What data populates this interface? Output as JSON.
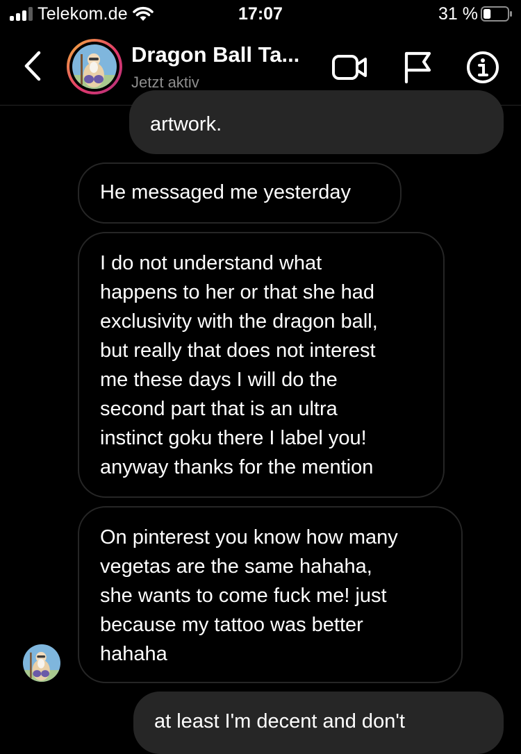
{
  "status_bar": {
    "carrier": "Telekom.de",
    "time": "17:07",
    "battery_percent": "31 %",
    "battery_level": 0.31,
    "signal_bars_active": 3,
    "signal_bars_total": 4
  },
  "header": {
    "title": "Dragon Ball Ta...",
    "subtitle": "Jetzt aktiv",
    "icons": [
      "back-chevron-icon",
      "video-camera-icon",
      "flag-icon",
      "info-icon"
    ]
  },
  "messages": [
    {
      "direction": "sent",
      "lines": [
        "artwork."
      ]
    },
    {
      "direction": "received",
      "lines": [
        "He messaged me yesterday"
      ]
    },
    {
      "direction": "received",
      "lines": [
        "I do not understand what",
        "happens to her or that she had",
        "exclusivity with the dragon ball,",
        "but really that does not interest",
        "me these days I will do the",
        "second part that is an ultra",
        "instinct goku there I label you!",
        "anyway thanks for the mention"
      ]
    },
    {
      "direction": "received",
      "lines": [
        "On pinterest you know how many",
        "vegetas are the same hahaha,",
        "she wants to come fuck me! just",
        "because my tattoo was better",
        "hahaha"
      ]
    },
    {
      "direction": "sent",
      "lines": [
        "at least I'm decent and don't"
      ]
    }
  ],
  "colors": {
    "background": "#000000",
    "sent_bubble": "#262626",
    "received_border": "#262626",
    "secondary_text": "#8e8e8e",
    "story_ring": [
      "#f5b63b",
      "#e2396a",
      "#b1317d"
    ]
  }
}
